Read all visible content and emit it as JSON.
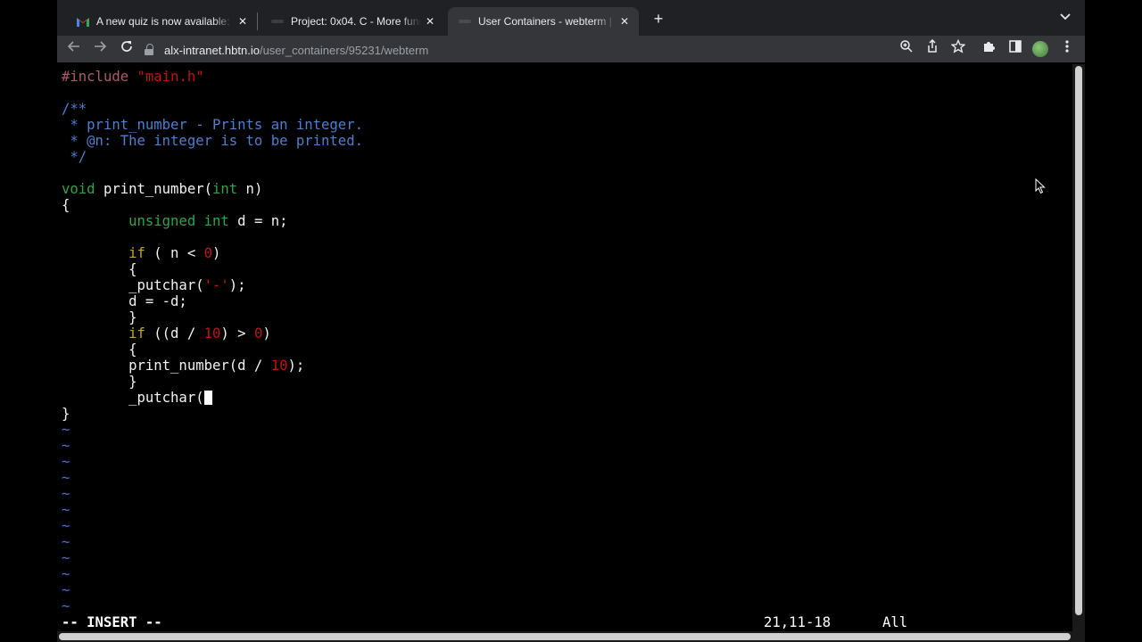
{
  "tabs": [
    {
      "title": "A new quiz is now available: Ev",
      "favicon": "gmail-icon",
      "active": false
    },
    {
      "title": "Project: 0x04. C - More functio",
      "favicon": "alx-icon",
      "active": false
    },
    {
      "title": "User Containers - webterm | A",
      "favicon": "alx-icon",
      "active": true
    }
  ],
  "toolbar": {
    "url_host": "alx-intranet.hbtn.io",
    "url_path": "/user_containers/95231/webterm",
    "icons": [
      "back-icon",
      "forward-icon",
      "reload-icon",
      "lock-icon",
      "zoom-icon",
      "share-icon",
      "star-icon",
      "extensions-icon",
      "sidepanel-icon",
      "profile-avatar",
      "more-menu-icon"
    ]
  },
  "editor": {
    "lines": [
      {
        "type": "pre",
        "text": "#include "
      },
      {
        "type": "blank"
      },
      {
        "type": "comment",
        "text": "/**"
      },
      {
        "type": "comment",
        "text": " * print_number - Prints an integer."
      },
      {
        "type": "comment",
        "text": " * @n: The integer is to be printed."
      },
      {
        "type": "comment",
        "text": " */"
      },
      {
        "type": "blank"
      },
      {
        "type": "code"
      },
      {
        "type": "code",
        "text": "{"
      },
      {
        "type": "code"
      },
      {
        "type": "blank"
      },
      {
        "type": "code"
      },
      {
        "type": "code",
        "text": "        {"
      },
      {
        "type": "code"
      },
      {
        "type": "code",
        "text": "        d = -d;"
      },
      {
        "type": "code",
        "text": "        }"
      },
      {
        "type": "code"
      },
      {
        "type": "code",
        "text": "        {"
      },
      {
        "type": "code"
      },
      {
        "type": "code",
        "text": "        }"
      },
      {
        "type": "code"
      },
      {
        "type": "code",
        "text": "}"
      }
    ],
    "include_file": "\"main.h\"",
    "func_sig": {
      "ret": "void",
      "name": " print_number(",
      "ptype": "int",
      "param": " n)"
    },
    "decl": {
      "indent": "        ",
      "kw1": "unsigned",
      "kw2": "int",
      "rest": " d = n;"
    },
    "if1": {
      "indent": "        ",
      "kw": "if",
      "pre": " ( n < ",
      "num": "0",
      "post": ")"
    },
    "putchar1": {
      "code": "        _putchar(",
      "char": "'-'",
      "post": ");"
    },
    "if2": {
      "indent": "        ",
      "kw": "if",
      "pre": " ((d / ",
      "num1": "10",
      "mid": ") > ",
      "num2": "0",
      "post": ")"
    },
    "recurse": {
      "code": "        print_number(d / ",
      "num": "10",
      "post": ");"
    },
    "putchar2": {
      "code": "        _putchar("
    },
    "tilde": "~",
    "tilde_count": 12,
    "mode": "-- INSERT --",
    "position": "21,11-18",
    "scroll": "All"
  }
}
